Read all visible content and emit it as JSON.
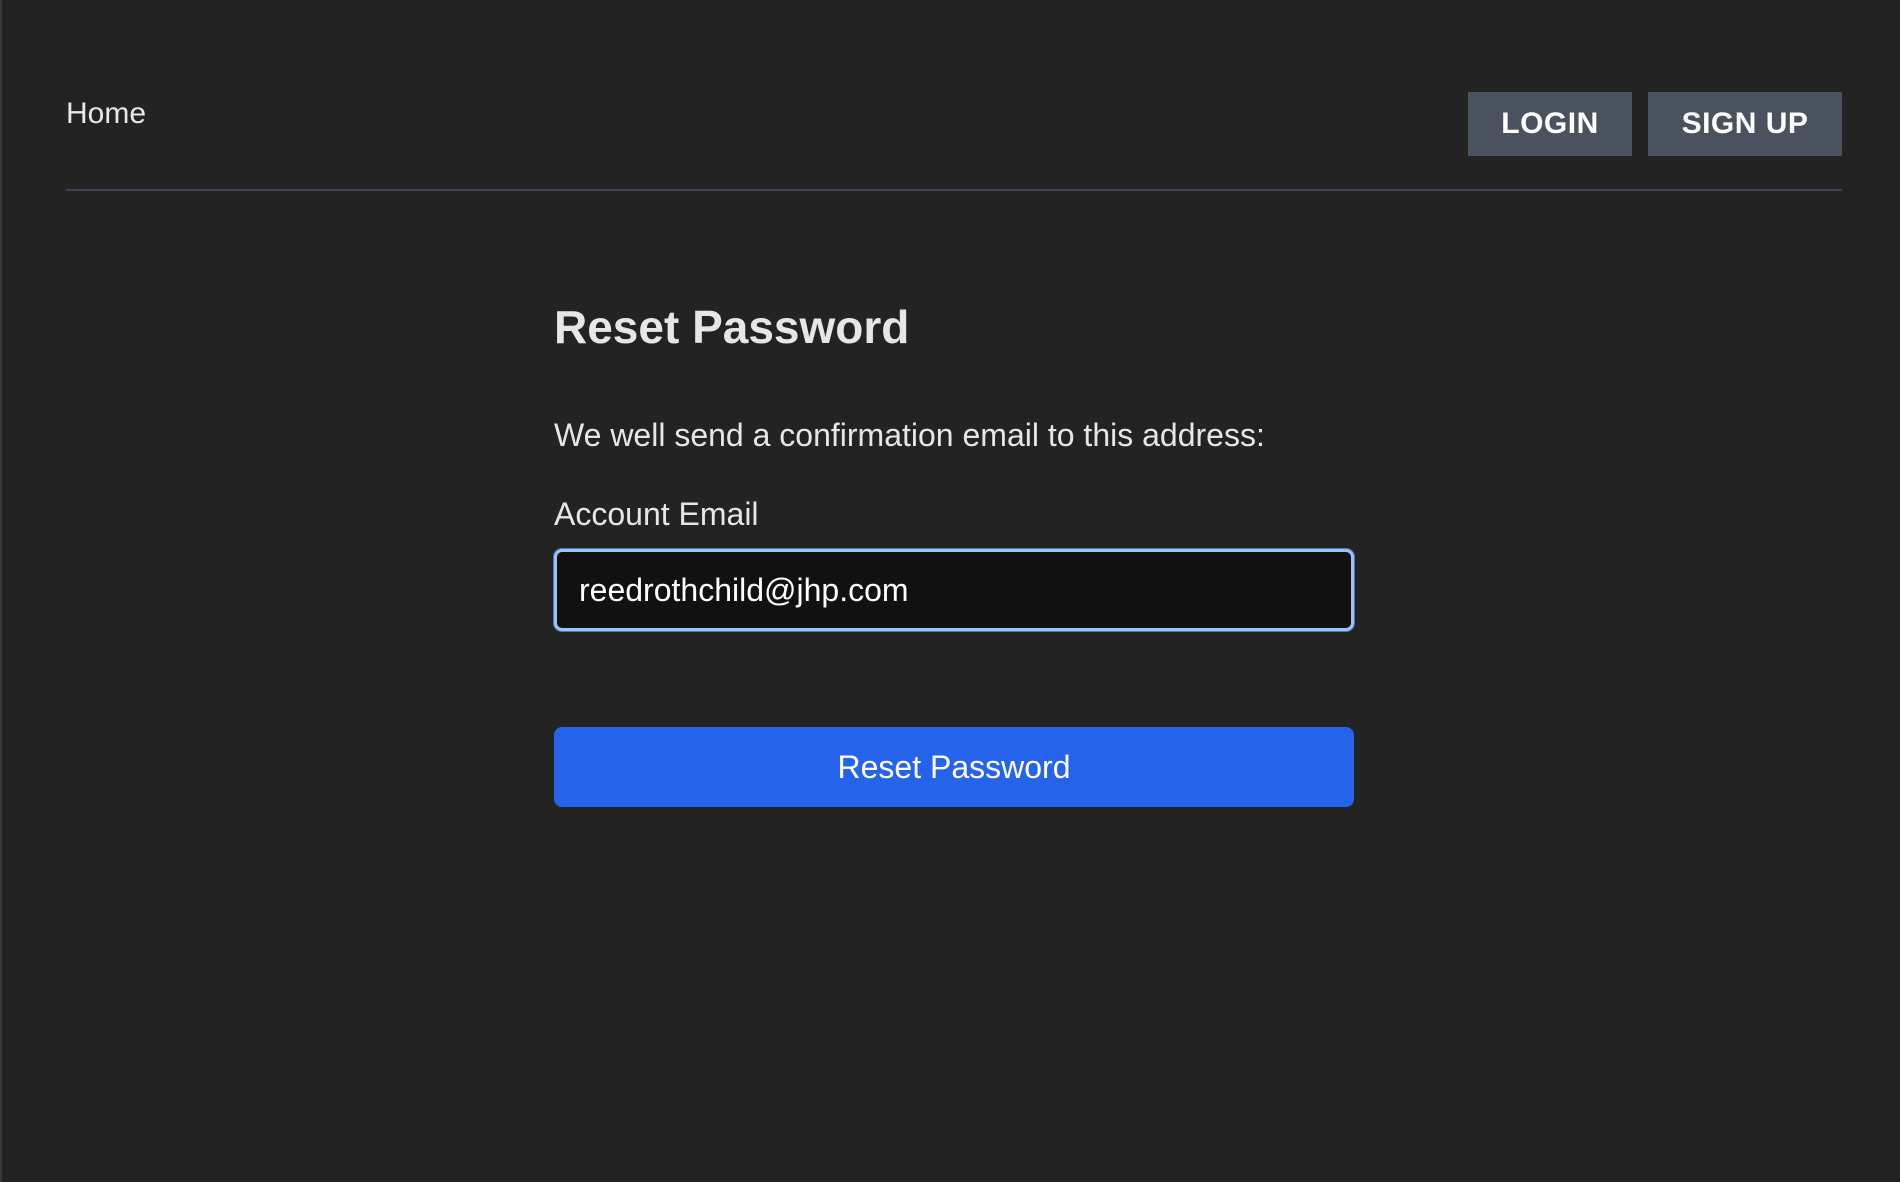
{
  "nav": {
    "home_label": "Home",
    "login_label": "LOGIN",
    "signup_label": "SIGN UP"
  },
  "form": {
    "title": "Reset Password",
    "description": "We well send a confirmation email to this address:",
    "email_label": "Account Email",
    "email_value": "reedrothchild@jhp.com",
    "submit_label": "Reset Password"
  },
  "colors": {
    "background": "#232323",
    "auth_button": "#4a5260",
    "primary_button": "#2563eb",
    "input_focus_border": "#9cc3f5"
  }
}
